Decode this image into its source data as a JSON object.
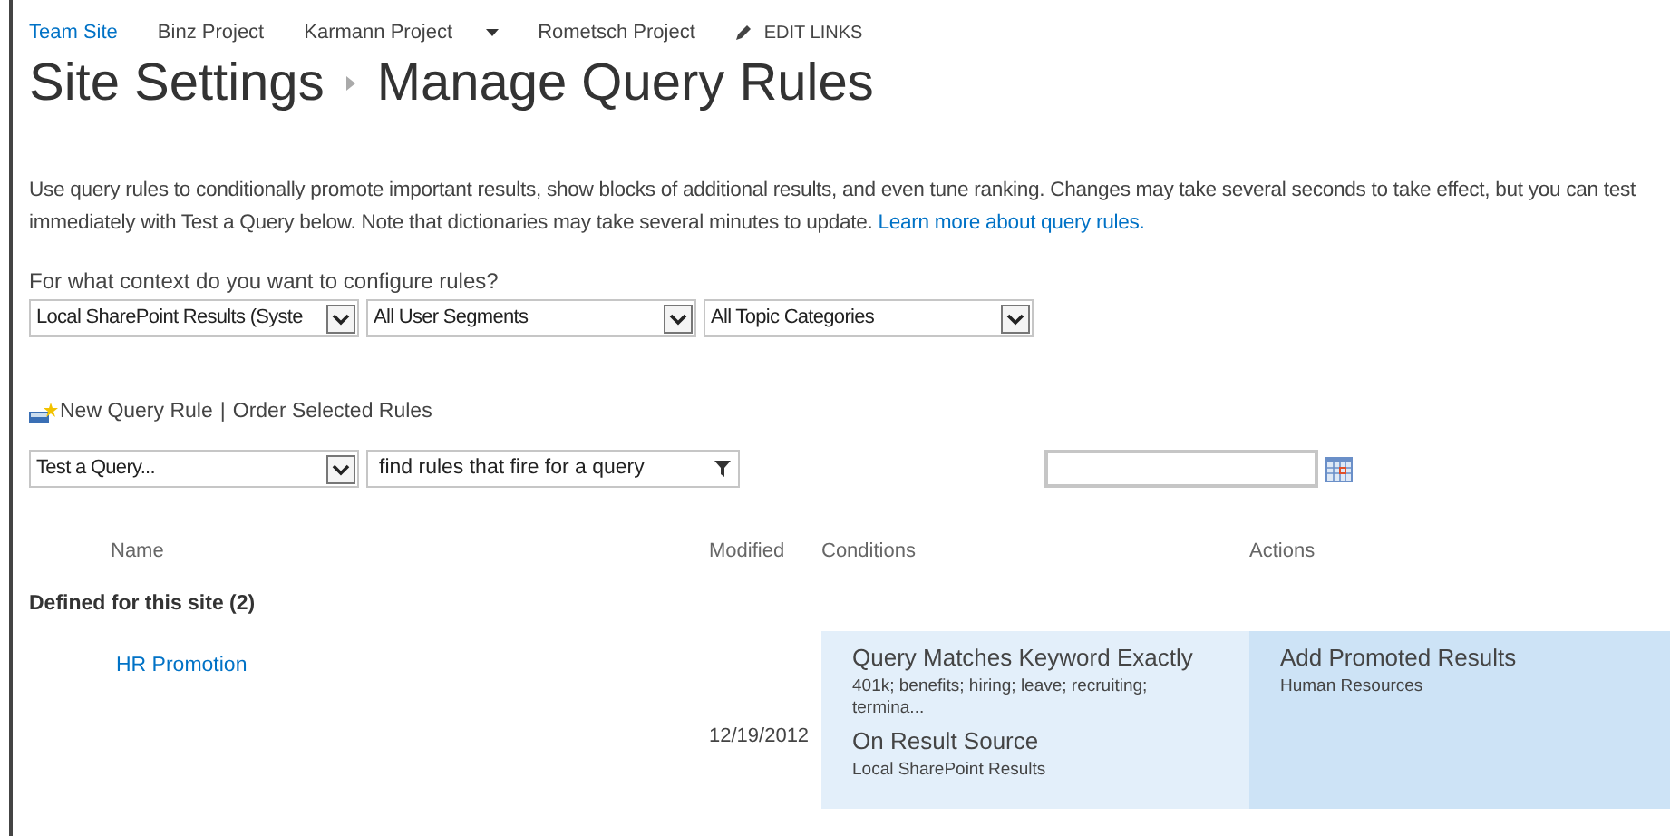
{
  "nav": [
    {
      "label": "Team Site",
      "selected": true,
      "dropdown": false
    },
    {
      "label": "Binz Project",
      "selected": false,
      "dropdown": false
    },
    {
      "label": "Karmann Project",
      "selected": false,
      "dropdown": true
    },
    {
      "label": "Rometsch Project",
      "selected": false,
      "dropdown": false
    }
  ],
  "edit_links": "EDIT LINKS",
  "breadcrumb": [
    "Site Settings",
    "Manage Query Rules"
  ],
  "description": {
    "text": "Use query rules to conditionally promote important results, show blocks of additional results, and even tune ranking. Changes may take several seconds to take effect, but you can test immediately with Test a Query below. Note that dictionaries may take several minutes to update.",
    "link": "Learn more about query rules."
  },
  "context": {
    "label": "For what context do you want to configure rules?",
    "selects": [
      "Local SharePoint Results (Syste",
      "All User Segments",
      "All Topic Categories"
    ]
  },
  "actions": [
    "New Query Rule",
    "Order Selected Rules"
  ],
  "actions_separator": "|",
  "test": {
    "select": "Test a Query...",
    "filter_placeholder": "find rules that fire for a query"
  },
  "table": {
    "columns": [
      "Name",
      "Modified",
      "Conditions",
      "Actions"
    ],
    "group": "Defined for this site (2)",
    "rows": [
      {
        "name": "HR Promotion",
        "modified": "12/19/2012",
        "conditions": [
          {
            "title": "Query Matches Keyword Exactly",
            "detail": "401k; benefits; hiring; leave; recruiting; termina..."
          },
          {
            "title": "On Result Source",
            "detail": "Local SharePoint Results"
          }
        ],
        "actions": [
          {
            "title": "Add Promoted Results",
            "detail": "Human Resources"
          }
        ]
      }
    ]
  }
}
